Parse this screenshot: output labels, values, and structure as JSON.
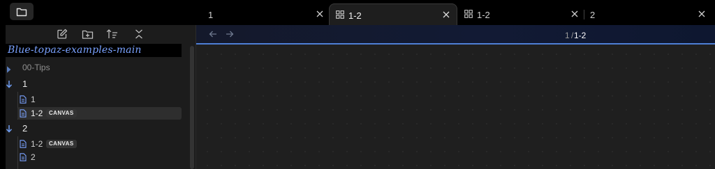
{
  "tabs": [
    {
      "label": "1",
      "icon": "note-icon",
      "active": false
    },
    {
      "label": "1-2",
      "icon": "canvas-icon",
      "active": true
    },
    {
      "label": "1-2",
      "icon": "canvas-icon",
      "active": false
    },
    {
      "label": "2",
      "icon": "note-icon",
      "active": false
    }
  ],
  "sidebar": {
    "toolbar": [
      "new-note-icon",
      "new-folder-icon",
      "sort-icon",
      "collapse-all-icon"
    ],
    "vault_title": "Blue-topaz-examples-main",
    "tree": {
      "tips_folder": "00-Tips",
      "folder_1": {
        "label": "1",
        "files": [
          {
            "label": "1",
            "badge": ""
          },
          {
            "label": "1-2",
            "badge": "CANVAS"
          }
        ]
      },
      "folder_2": {
        "label": "2",
        "files": [
          {
            "label": "1-2",
            "badge": "CANVAS"
          },
          {
            "label": "2",
            "badge": ""
          }
        ]
      }
    }
  },
  "main": {
    "breadcrumb_parent": "1",
    "breadcrumb_sep": "/",
    "breadcrumb_current": "1-2"
  },
  "colors": {
    "accent": "#4e7fd6",
    "vault_title": "#7aa2ff",
    "chevron": "#6e9cf0"
  }
}
